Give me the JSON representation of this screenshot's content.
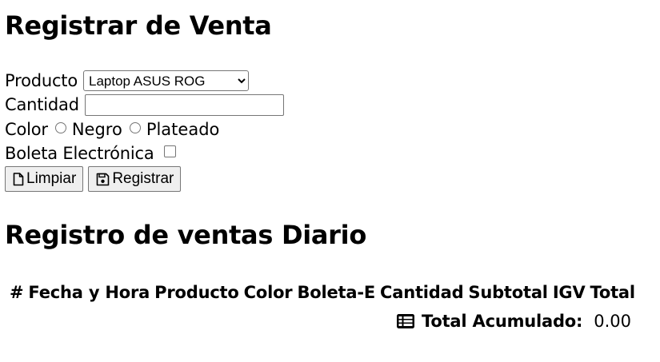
{
  "sale_form": {
    "title": "Registrar de Venta",
    "product_label": "Producto",
    "product_selected": "Laptop ASUS ROG",
    "quantity_label": "Cantidad",
    "quantity_value": "",
    "color_label": "Color",
    "color_options": [
      "Negro",
      "Plateado"
    ],
    "boleta_label": "Boleta Electrónica",
    "clear_button": "Limpiar",
    "register_button": "Registrar"
  },
  "registry": {
    "title": "Registro de ventas Diario",
    "columns": [
      "#",
      "Fecha y Hora",
      "Producto",
      "Color",
      "Boleta-E",
      "Cantidad",
      "Subtotal",
      "IGV",
      "Total"
    ],
    "total_label": "Total Acumulado:",
    "total_value": "0.00"
  },
  "icons": {
    "clear_icon": "file-icon",
    "register_icon": "save-icon",
    "total_icon": "table-list-icon"
  }
}
